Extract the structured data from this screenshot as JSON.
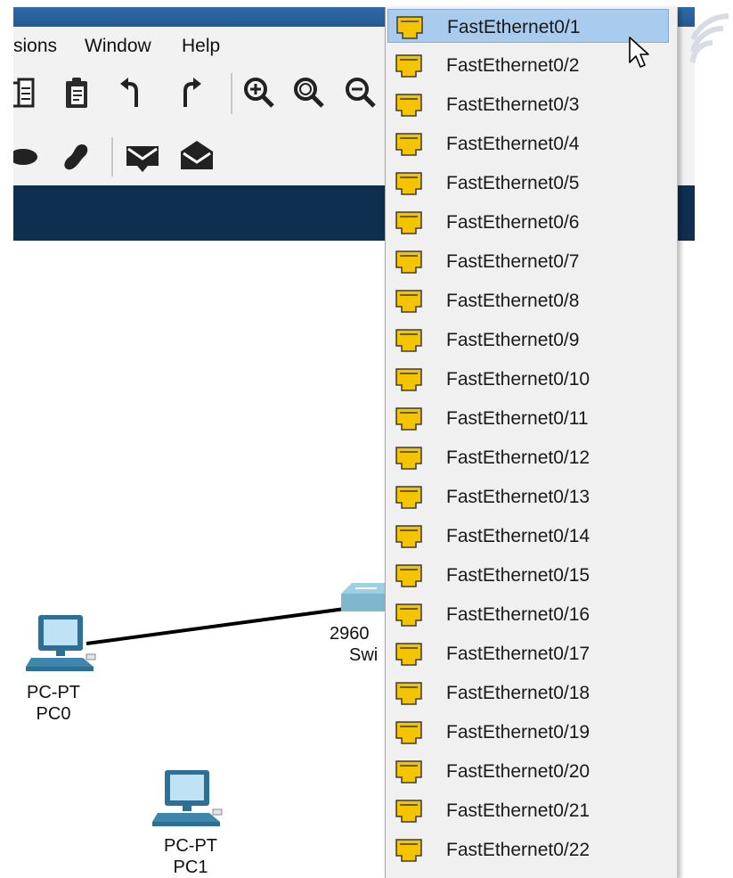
{
  "menu": {
    "items": [
      "sions",
      "Window",
      "Help"
    ]
  },
  "workspace": {
    "devices": [
      {
        "model": "PC-PT",
        "name": "PC0"
      },
      {
        "model": "PC-PT",
        "name": "PC1"
      },
      {
        "model": "2960",
        "name": "Swi"
      }
    ]
  },
  "dropdown": {
    "selected_index": 0,
    "items": [
      "FastEthernet0/1",
      "FastEthernet0/2",
      "FastEthernet0/3",
      "FastEthernet0/4",
      "FastEthernet0/5",
      "FastEthernet0/6",
      "FastEthernet0/7",
      "FastEthernet0/8",
      "FastEthernet0/9",
      "FastEthernet0/10",
      "FastEthernet0/11",
      "FastEthernet0/12",
      "FastEthernet0/13",
      "FastEthernet0/14",
      "FastEthernet0/15",
      "FastEthernet0/16",
      "FastEthernet0/17",
      "FastEthernet0/18",
      "FastEthernet0/19",
      "FastEthernet0/20",
      "FastEthernet0/21",
      "FastEthernet0/22"
    ]
  },
  "icons": {
    "port_icon": "ethernet-port-icon",
    "toolbar": [
      "paste-icon",
      "clipboard-icon",
      "undo-icon",
      "redo-icon",
      "zoom-in-icon",
      "zoom-reset-icon",
      "zoom-out-icon",
      "ellipse-tool-icon",
      "freeform-tool-icon",
      "simple-pdu-icon",
      "complex-pdu-icon"
    ]
  },
  "colors": {
    "titlebar": "#2f6aa6",
    "navbar": "#0f2f50",
    "port_icon": "#f5c400",
    "selection": "#a9cbee"
  }
}
